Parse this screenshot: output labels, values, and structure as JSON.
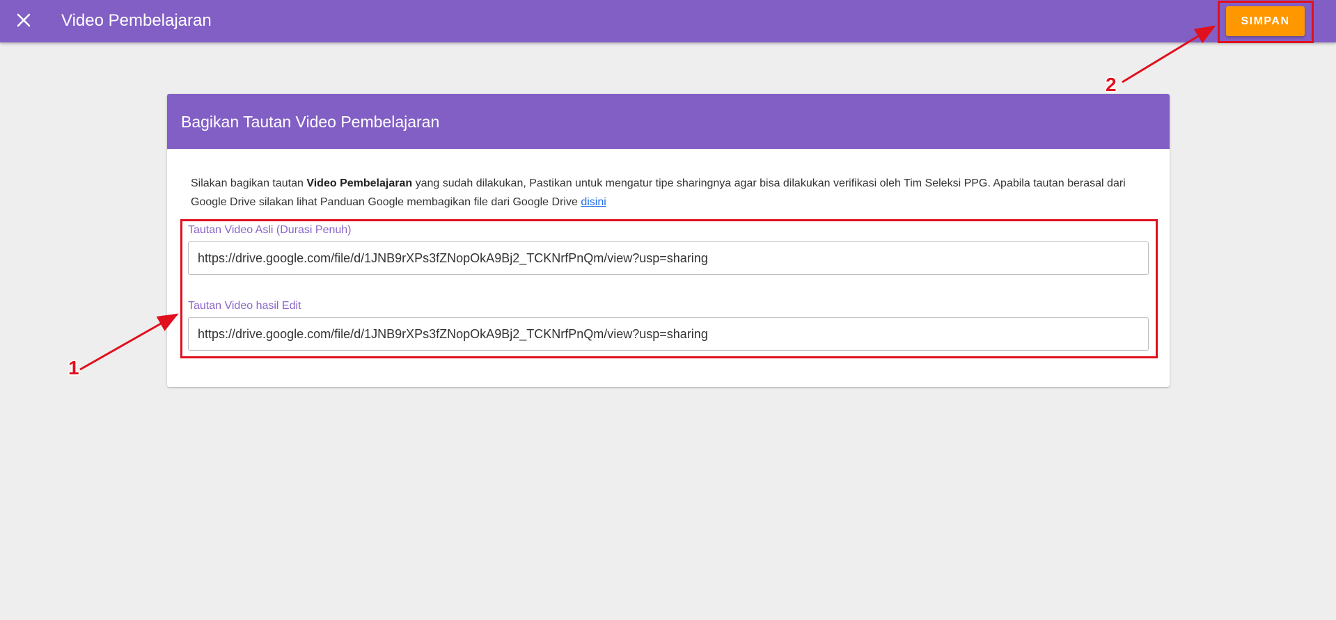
{
  "header": {
    "title": "Video Pembelajaran",
    "close_icon": "close-icon",
    "save_label": "SIMPAN",
    "accent_color": "#825fc5",
    "save_color": "#ff9800"
  },
  "card": {
    "title": "Bagikan Tautan Video Pembelajaran",
    "info": {
      "part1": "Silakan bagikan tautan ",
      "bold": "Video Pembelajaran",
      "part2": " yang sudah dilakukan, Pastikan untuk mengatur tipe sharingnya agar bisa dilakukan verifikasi oleh Tim Seleksi PPG. Apabila tautan berasal dari Google Drive silakan lihat Panduan Google membagikan file dari Google Drive ",
      "link": "disini"
    },
    "fields": [
      {
        "label": "Tautan Video Asli (Durasi Penuh)",
        "value": "https://drive.google.com/file/d/1JNB9rXPs3fZNopOkA9Bj2_TCKNrfPnQm/view?usp=sharing"
      },
      {
        "label": "Tautan Video hasil Edit",
        "value": "https://drive.google.com/file/d/1JNB9rXPs3fZNopOkA9Bj2_TCKNrfPnQm/view?usp=sharing"
      }
    ]
  },
  "annotations": {
    "marker_1": "1",
    "marker_2": "2",
    "highlight_color": "#e0101e"
  }
}
